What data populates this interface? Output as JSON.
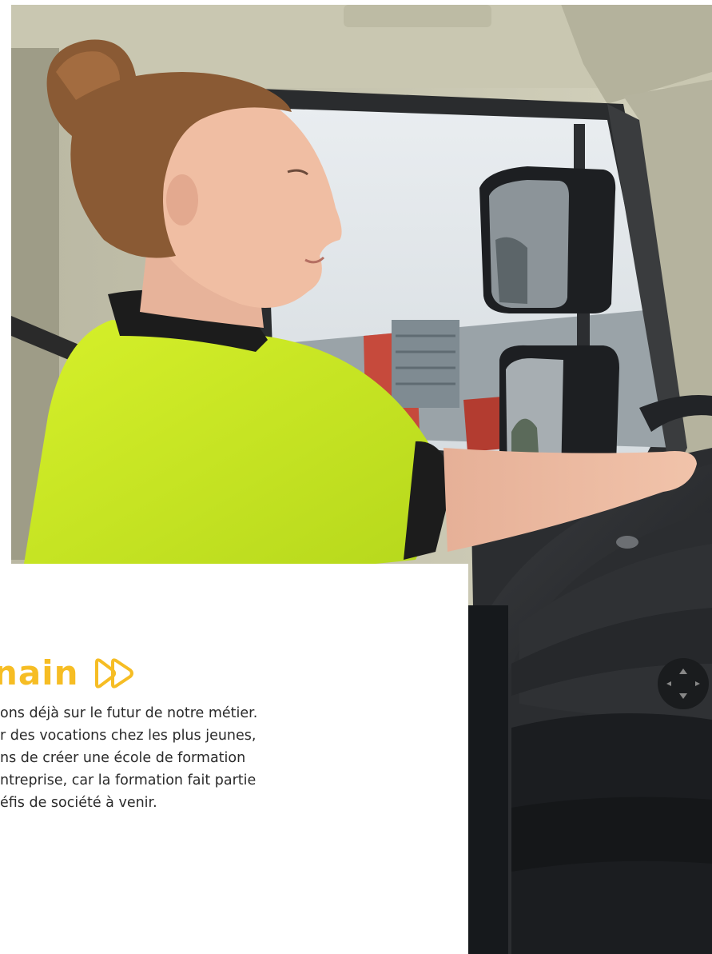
{
  "photo": {
    "alt_subject": "truck-driver-cab-photo"
  },
  "colors": {
    "accent": "#f6bd24",
    "text": "#2a2a2a",
    "card_bg": "#ffffff",
    "dark_strip": "#16191c"
  },
  "card": {
    "title": "nain",
    "icon": "fast-forward-icon",
    "lines": [
      "ons déjà sur le futur de notre métier.",
      "r des vocations chez les plus jeunes,",
      "ns de créer une école de formation",
      "ntreprise, car la formation fait partie",
      "éfis de société à venir."
    ]
  }
}
